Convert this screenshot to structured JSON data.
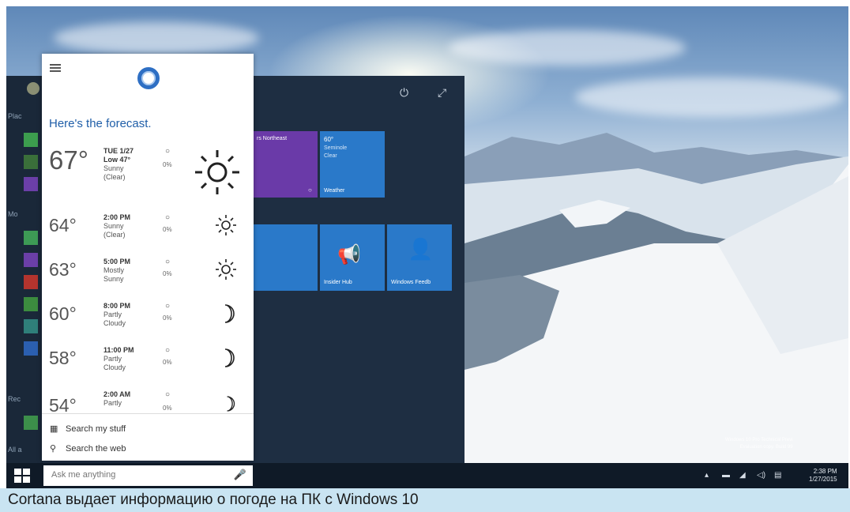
{
  "cortana": {
    "heading": "Here's the forecast.",
    "forecast": [
      {
        "temp": "67°",
        "time": "TUE 1/27",
        "low": "Low 47°",
        "cond1": "Sunny",
        "cond2": "(Clear)",
        "precip": "0%",
        "icon": "sun-icon"
      },
      {
        "temp": "64°",
        "time": "2:00 PM",
        "cond1": "Sunny",
        "cond2": "(Clear)",
        "precip": "0%",
        "icon": "sun-icon"
      },
      {
        "temp": "63°",
        "time": "5:00 PM",
        "cond1": "Mostly",
        "cond2": "Sunny",
        "precip": "0%",
        "icon": "sun-icon"
      },
      {
        "temp": "60°",
        "time": "8:00 PM",
        "cond1": "Partly",
        "cond2": "Cloudy",
        "precip": "0%",
        "icon": "moon-icon"
      },
      {
        "temp": "58°",
        "time": "11:00 PM",
        "cond1": "Partly",
        "cond2": "Cloudy",
        "precip": "0%",
        "icon": "moon-icon"
      },
      {
        "temp": "54°",
        "time": "2:00 AM",
        "cond1": "Partly",
        "cond2": "",
        "precip": "0%",
        "icon": "moon-icon"
      }
    ],
    "search_my_stuff": "Search my stuff",
    "search_web": "Search the web"
  },
  "start_menu": {
    "rail_labels": [
      "Plac",
      "Mo",
      "Rec",
      "All a"
    ],
    "tiles": {
      "news": "rs Northeast",
      "weather_temp": "60°",
      "weather_place": "Seminole",
      "weather_cond": "Clear",
      "weather_label": "Weather",
      "insider_hub": "Insider Hub",
      "windows_feedback": "Windows Feedb"
    }
  },
  "taskbar": {
    "search_placeholder": "Ask me anything",
    "time": "2:38 PM",
    "date": "1/27/2015"
  },
  "watermark": {
    "line1": "Windows 10 Pro Technical Previ",
    "line2": "Evaluation copy. Build 99"
  },
  "caption": "Cortana выдает информацию о погоде на ПК с Windows 10",
  "colors": {
    "cortana_blue": "#2e6fc4",
    "start_bg": "#1e2e42",
    "tile_purple": "#6a3aa8",
    "tile_blue": "#2a79c9",
    "caption_bg": "#c9e4f2"
  }
}
